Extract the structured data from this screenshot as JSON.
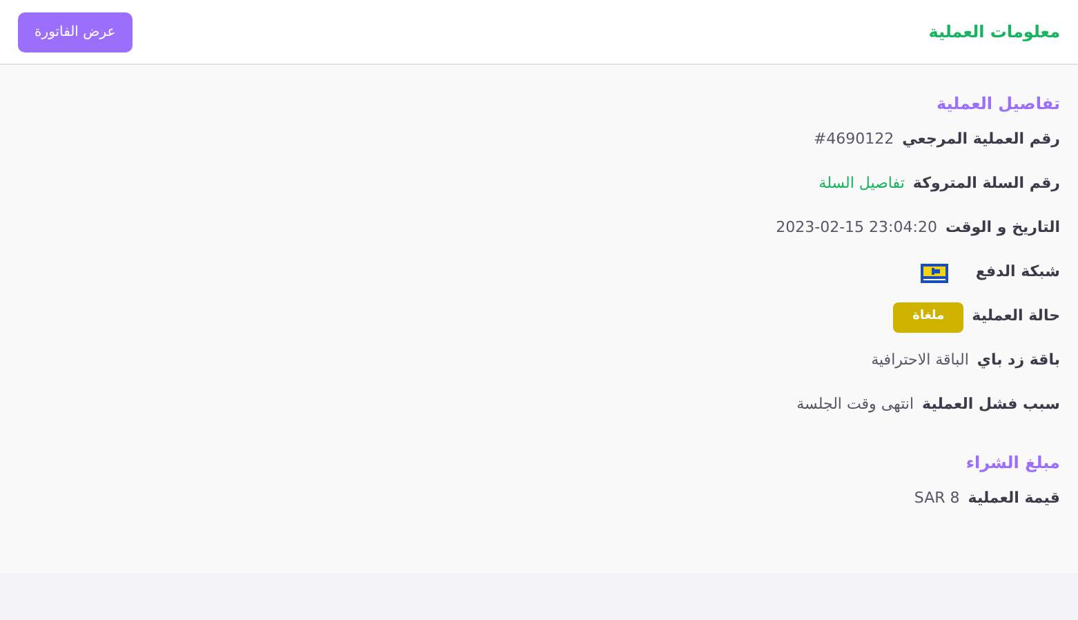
{
  "header": {
    "title": "معلومات العملية",
    "button": "عرض الفاتورة"
  },
  "sections": [
    {
      "title": "تفاصيل العملية",
      "rows": [
        {
          "kind": "text",
          "label": "رقم العملية المرجعي",
          "value": "#4690122"
        },
        {
          "kind": "link",
          "label": "رقم السلة المتروكة",
          "value": "تفاصيل السلة"
        },
        {
          "kind": "text",
          "label": "التاريخ و الوقت",
          "value": "2023-02-15 23:04:20"
        },
        {
          "kind": "logo",
          "label": "شبكة الدفع"
        },
        {
          "kind": "badge",
          "label": "حالة العملية",
          "value": "ملغاة",
          "color": "#cdb300"
        },
        {
          "kind": "text",
          "label": "باقة زد باي",
          "value": "الباقة الاحترافية"
        },
        {
          "kind": "text",
          "label": "سبب فشل العملية",
          "value": "انتهى وقت الجلسة"
        }
      ]
    },
    {
      "title": "مبلغ الشراء",
      "rows": [
        {
          "kind": "text",
          "label": "قيمة العملية",
          "value": "SAR 8"
        }
      ]
    }
  ]
}
